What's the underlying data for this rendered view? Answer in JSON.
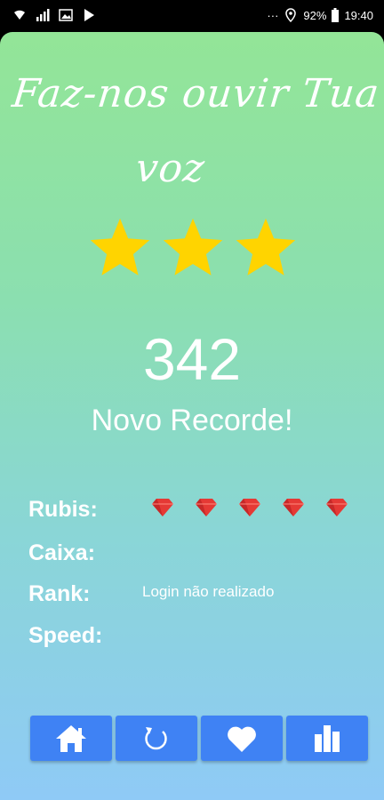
{
  "status_bar": {
    "left_icons": [
      "wifi-icon",
      "signal-icon",
      "image-icon",
      "play-store-icon"
    ],
    "dots": "···",
    "battery": "92%",
    "time": "19:40"
  },
  "title": {
    "line1": "Faz-nos ouvir Tua",
    "line2": "voz"
  },
  "stars": {
    "earned": 3,
    "total": 3,
    "color": "#ffd400"
  },
  "score": "342",
  "record_text": "Novo Recorde!",
  "stats": {
    "rubis_label": "Rubis:",
    "rubis_count": 5,
    "caixa_label": "Caixa:",
    "rank_label": "Rank:",
    "rank_value": "Login não realizado",
    "speed_label": "Speed:"
  },
  "buttons": [
    "home-icon",
    "refresh-icon",
    "heart-icon",
    "leaderboard-icon"
  ],
  "colors": {
    "button": "#3f82f4",
    "gem": "#e53935",
    "star": "#ffd400"
  }
}
